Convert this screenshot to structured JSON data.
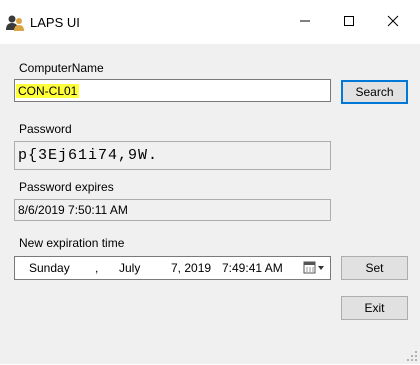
{
  "window": {
    "title": "LAPS UI",
    "icon": "users-icon",
    "controls": [
      "minimize-icon",
      "maximize-icon",
      "close-icon"
    ]
  },
  "computer_name": {
    "label": "ComputerName",
    "value": "CON-CL01",
    "highlight_color": "#ffff3c"
  },
  "search_button": {
    "label": "Search"
  },
  "password": {
    "label": "Password",
    "value": "p{3Ej61i74,9W."
  },
  "password_expires": {
    "label": "Password expires",
    "value": "8/6/2019 7:50:11 AM"
  },
  "new_expiration": {
    "label": "New expiration time",
    "weekday": "Sunday",
    "sep": ",",
    "month": "July",
    "day_year": "7, 2019",
    "time": "7:49:41 AM",
    "dropdown_icon": "calendar-dropdown-icon"
  },
  "set_button": {
    "label": "Set"
  },
  "exit_button": {
    "label": "Exit"
  },
  "colors": {
    "accent": "#0078d7",
    "form_bg": "#f0f0f0"
  }
}
